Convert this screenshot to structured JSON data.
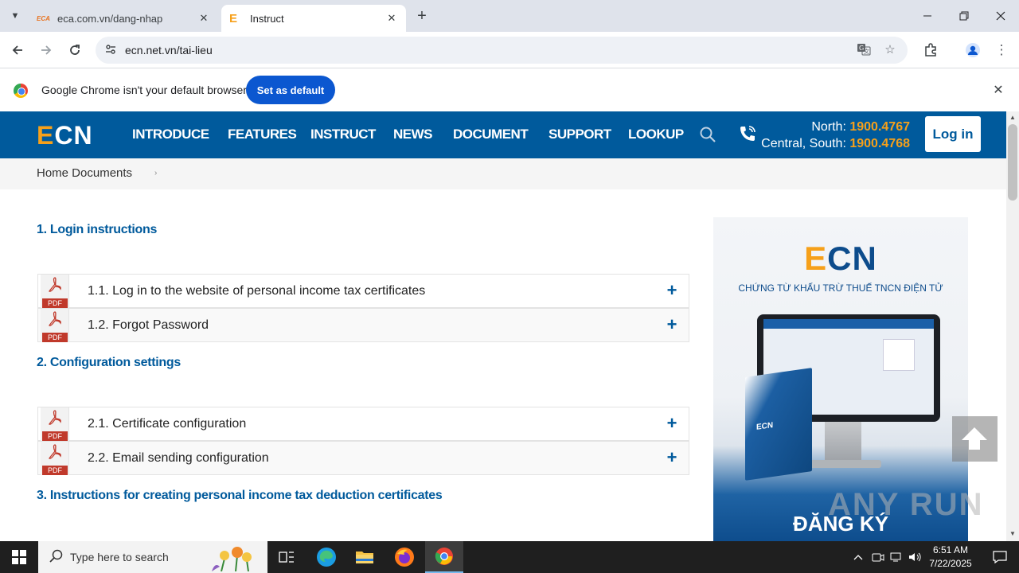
{
  "browser": {
    "tabs": [
      {
        "favicon": "ECA",
        "title": "eca.com.vn/dang-nhap",
        "active": false
      },
      {
        "favicon": "E",
        "title": "Instruct",
        "active": true
      }
    ],
    "url": "ecn.net.vn/tai-lieu",
    "infobar": {
      "message": "Google Chrome isn't your default browser",
      "button": "Set as default"
    }
  },
  "site": {
    "logo": {
      "first": "E",
      "rest": "CN"
    },
    "nav": [
      "INTRODUCE",
      "FEATURES",
      "INSTRUCT",
      "NEWS",
      "DOCUMENT",
      "SUPPORT",
      "LOOKUP"
    ],
    "hotline": {
      "north_label": "North:",
      "north_number": "1900.4767",
      "south_label": "Central, South:",
      "south_number": "1900.4768"
    },
    "login_label": "Log in",
    "breadcrumb": "Home Documents",
    "breadcrumb_sep": "›",
    "sections": [
      {
        "title": "1. Login instructions",
        "docs": [
          "1.1. Log in to the website of personal income tax certificates",
          "1.2. Forgot Password"
        ]
      },
      {
        "title": "2. Configuration settings",
        "docs": [
          "2.1. Certificate configuration",
          "2.2. Email sending configuration"
        ]
      },
      {
        "title": "3. Instructions for creating personal income tax deduction certificates",
        "docs": []
      }
    ],
    "pdf_label": "PDF",
    "expand_symbol": "+",
    "banner": {
      "logo_first": "E",
      "logo_rest": "CN",
      "subtitle": "CHỨNG TỪ KHẤU TRỪ THUẾ TNCN ĐIỆN TỬ",
      "cta": "ĐĂNG KÝ",
      "box_label": "ECN"
    },
    "watermark": "ANY RUN"
  },
  "taskbar": {
    "search_placeholder": "Type here to search",
    "time": "6:51 AM",
    "date": "7/22/2025"
  },
  "colors": {
    "brand_blue": "#005a9c",
    "brand_orange": "#f6a01a",
    "chrome_blue": "#0b57d0"
  }
}
